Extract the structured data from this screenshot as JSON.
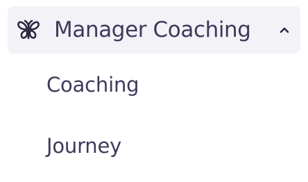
{
  "nav": {
    "group": {
      "icon": "butterfly-icon",
      "label": "Manager Coaching",
      "expanded": true,
      "chevron_icon": "chevron-up-icon"
    },
    "items": [
      {
        "label": "Coaching"
      },
      {
        "label": "Journey"
      }
    ]
  },
  "colors": {
    "text": "#3d3a5c",
    "header_background": "#f3f2f6"
  }
}
